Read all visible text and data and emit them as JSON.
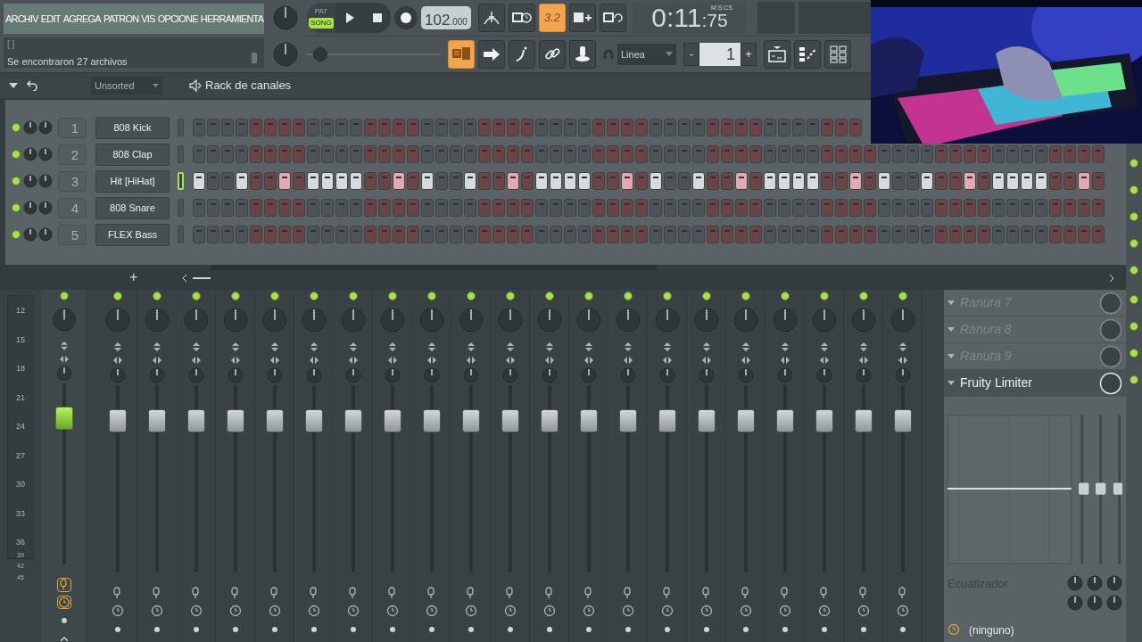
{
  "menu": [
    {
      "label": "ARCHIV"
    },
    {
      "label": "EDIT"
    },
    {
      "label": "AGREGA"
    },
    {
      "label": "PATRON"
    },
    {
      "label": "VIS"
    },
    {
      "label": "OPCIONE"
    },
    {
      "label": "HERRAMIENTA"
    }
  ],
  "hint": {
    "brackets": "[   ]",
    "message": "Se encontraron 27 archivos"
  },
  "modes": [
    {
      "label": "PAT",
      "selected": false
    },
    {
      "label": "SONG",
      "selected": true
    }
  ],
  "tempo": {
    "whole": "102",
    "fraction": ".000"
  },
  "toolbar": [
    {
      "kind": "metronome",
      "active": false
    },
    {
      "kind": "wait",
      "active": false
    },
    {
      "kind": "label",
      "label": "3.2",
      "active": true
    },
    {
      "kind": "step-add",
      "active": false
    },
    {
      "kind": "loop-record",
      "active": false
    }
  ],
  "time": {
    "main": "0:11",
    "centis": ":75",
    "format": "M:S:CS"
  },
  "tools": [
    {
      "kind": "typing",
      "active": true
    },
    {
      "kind": "arrow",
      "active": false
    },
    {
      "kind": "slide",
      "active": false
    },
    {
      "kind": "link",
      "active": false
    },
    {
      "kind": "stamp",
      "active": false
    }
  ],
  "pitch": {
    "level": 0.05
  },
  "snap": {
    "value": "Linea"
  },
  "pattern": {
    "value": "1",
    "minus": "-",
    "plus": "+"
  },
  "windows": [
    {
      "kind": "playlist"
    },
    {
      "kind": "steps"
    },
    {
      "kind": "mixer"
    }
  ],
  "rack": {
    "filter": "Unsorted",
    "title": "Rack de canales",
    "add": "+"
  },
  "channels": [
    {
      "number": "1",
      "name": "808 Kick",
      "selected": false,
      "steps": [
        false,
        false,
        false,
        false,
        false,
        false,
        false,
        false,
        false,
        false,
        false,
        false,
        false,
        false,
        false,
        false,
        false,
        false,
        false,
        false,
        false,
        false,
        false,
        false,
        false,
        false,
        false,
        false,
        false,
        false,
        false,
        false,
        false,
        false,
        false,
        false,
        false,
        false,
        false,
        false,
        false,
        false,
        false,
        false,
        false,
        false,
        false
      ]
    },
    {
      "number": "2",
      "name": "808 Clap",
      "selected": false,
      "steps": [
        false,
        false,
        false,
        false,
        false,
        false,
        false,
        false,
        false,
        false,
        false,
        false,
        false,
        false,
        false,
        false,
        false,
        false,
        false,
        false,
        false,
        false,
        false,
        false,
        false,
        false,
        false,
        false,
        false,
        false,
        false,
        false,
        false,
        false,
        false,
        false,
        false,
        false,
        false,
        false,
        false,
        false,
        false,
        false,
        false,
        false,
        false,
        false,
        false,
        false,
        false,
        false,
        false,
        false,
        false,
        false,
        false,
        false,
        false,
        false,
        false,
        false,
        false,
        false
      ]
    },
    {
      "number": "3",
      "name": "Hit [HiHat]",
      "selected": true,
      "steps": [
        true,
        false,
        false,
        true,
        false,
        false,
        true,
        false,
        true,
        true,
        true,
        true,
        false,
        false,
        true,
        false,
        true,
        false,
        false,
        true,
        false,
        false,
        true,
        false,
        true,
        true,
        true,
        true,
        false,
        false,
        true,
        false,
        true,
        false,
        false,
        true,
        false,
        false,
        true,
        false,
        true,
        true,
        true,
        true,
        false,
        false,
        true,
        false,
        true,
        false,
        false,
        true,
        false,
        false,
        true,
        false,
        true,
        true,
        true,
        true,
        false,
        false,
        true,
        false
      ]
    },
    {
      "number": "4",
      "name": "808 Snare",
      "selected": false,
      "steps": [
        false,
        false,
        false,
        false,
        false,
        false,
        false,
        false,
        false,
        false,
        false,
        false,
        false,
        false,
        false,
        false,
        false,
        false,
        false,
        false,
        false,
        false,
        false,
        false,
        false,
        false,
        false,
        false,
        false,
        false,
        false,
        false,
        false,
        false,
        false,
        false,
        false,
        false,
        false,
        false,
        false,
        false,
        false,
        false,
        false,
        false,
        false,
        false,
        false,
        false,
        false,
        false,
        false,
        false,
        false,
        false,
        false,
        false,
        false,
        false,
        false,
        false,
        false,
        false
      ]
    },
    {
      "number": "5",
      "name": "FLEX Bass",
      "selected": false,
      "steps": [
        false,
        false,
        false,
        false,
        false,
        false,
        false,
        false,
        false,
        false,
        false,
        false,
        false,
        false,
        false,
        false,
        false,
        false,
        false,
        false,
        false,
        false,
        false,
        false,
        false,
        false,
        false,
        false,
        false,
        false,
        false,
        false,
        false,
        false,
        false,
        false,
        false,
        false,
        false,
        false,
        false,
        false,
        false,
        false,
        false,
        false,
        false,
        false,
        false,
        false,
        false,
        false,
        false,
        false,
        false,
        false,
        false,
        false,
        false,
        false,
        false,
        false,
        false,
        false
      ]
    }
  ],
  "mixer": {
    "scale": [
      "12",
      "15",
      "18",
      "21",
      "24",
      "27",
      "30",
      "33",
      "36",
      "39",
      "42",
      "45"
    ],
    "tracks": [
      {
        "kind": "master",
        "selected": true,
        "level": 0.8
      },
      {
        "kind": "insert",
        "selected": false,
        "level": 0.8
      },
      {
        "kind": "insert",
        "selected": false,
        "level": 0.8
      },
      {
        "kind": "insert",
        "selected": false,
        "level": 0.8
      },
      {
        "kind": "insert",
        "selected": false,
        "level": 0.8
      },
      {
        "kind": "insert",
        "selected": false,
        "level": 0.8
      },
      {
        "kind": "insert",
        "selected": false,
        "level": 0.8
      },
      {
        "kind": "insert",
        "selected": false,
        "level": 0.8
      },
      {
        "kind": "insert",
        "selected": false,
        "level": 0.8
      },
      {
        "kind": "insert",
        "selected": false,
        "level": 0.8
      },
      {
        "kind": "insert",
        "selected": false,
        "level": 0.8
      },
      {
        "kind": "insert",
        "selected": false,
        "level": 0.8
      },
      {
        "kind": "insert",
        "selected": false,
        "level": 0.8
      },
      {
        "kind": "insert",
        "selected": false,
        "level": 0.8
      },
      {
        "kind": "insert",
        "selected": false,
        "level": 0.8
      },
      {
        "kind": "insert",
        "selected": false,
        "level": 0.8
      },
      {
        "kind": "insert",
        "selected": false,
        "level": 0.8
      },
      {
        "kind": "insert",
        "selected": false,
        "level": 0.8
      },
      {
        "kind": "insert",
        "selected": false,
        "level": 0.8
      },
      {
        "kind": "insert",
        "selected": false,
        "level": 0.8
      },
      {
        "kind": "insert",
        "selected": false,
        "level": 0.8
      },
      {
        "kind": "insert",
        "selected": false,
        "level": 0.8
      }
    ]
  },
  "effects": {
    "slots": [
      {
        "label": "Ranura 7",
        "kind": "empty"
      },
      {
        "label": "Ranura 8",
        "kind": "empty"
      },
      {
        "label": "Ranura 9",
        "kind": "empty"
      },
      {
        "label": "Fruity Limiter",
        "kind": "plugin"
      }
    ],
    "eq_label": "Ecualizador",
    "output": "(ninguno)"
  }
}
